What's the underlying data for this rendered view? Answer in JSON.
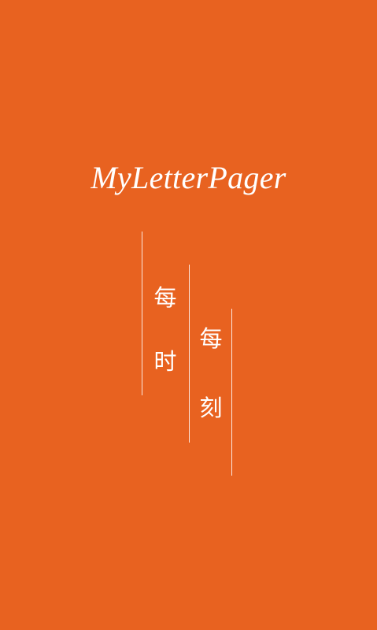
{
  "app": {
    "title": "MyLetterPager"
  },
  "slogan": {
    "column_1": [
      "每",
      "时"
    ],
    "column_2": [
      "每",
      "刻"
    ]
  },
  "colors": {
    "background": "#E86220",
    "text": "#FFFFFF",
    "line": "#FFFFFF"
  }
}
